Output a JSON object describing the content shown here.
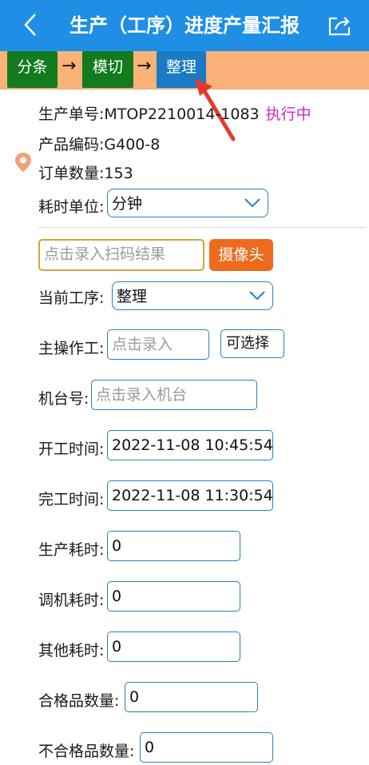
{
  "header": {
    "title": "生产（工序）进度产量汇报",
    "back_icon": "chevron-left-icon",
    "share_icon": "share-icon"
  },
  "flow": {
    "steps": [
      {
        "label": "分条",
        "color": "#137a1e"
      },
      {
        "label": "模切",
        "color": "#137a1e"
      },
      {
        "label": "整理",
        "color": "#1a7bc4"
      }
    ],
    "separator": "→"
  },
  "info": {
    "order_no_label": "生产单号:",
    "order_no": "MTOP2210014-1083",
    "status": "执行中",
    "product_code_label": "产品编码:",
    "product_code": "G400-8",
    "order_qty_label": "订单数量:",
    "order_qty": "153",
    "time_unit_label": "耗时单位:",
    "time_unit_value": "分钟"
  },
  "form": {
    "scan_placeholder": "点击录入扫码结果",
    "camera_label": "摄像头",
    "current_process_label": "当前工序:",
    "current_process_value": "整理",
    "operator_label": "主操作工:",
    "operator_placeholder": "点击录入",
    "choose_label": "可选择",
    "machine_label": "机台号:",
    "machine_placeholder": "点击录入机台",
    "start_label": "开工时间:",
    "start_value": "2022-11-08 10:45:54",
    "end_label": "完工时间:",
    "end_value": "2022-11-08 11:30:54",
    "prod_time_label": "生产耗时:",
    "prod_time_value": "0",
    "debug_time_label": "调机耗时:",
    "debug_time_value": "0",
    "other_time_label": "其他耗时:",
    "other_time_value": "0",
    "good_qty_label": "合格品数量:",
    "good_qty_value": "0",
    "bad_qty_label": "不合格品数量:",
    "bad_qty_value": "0"
  },
  "colors": {
    "header_bg": "#1f8fe6",
    "flowbar_bg": "#f9b277",
    "status": "#d125c9",
    "camera_btn": "#ee6a1d",
    "annotation_arrow": "#e53a2a"
  }
}
